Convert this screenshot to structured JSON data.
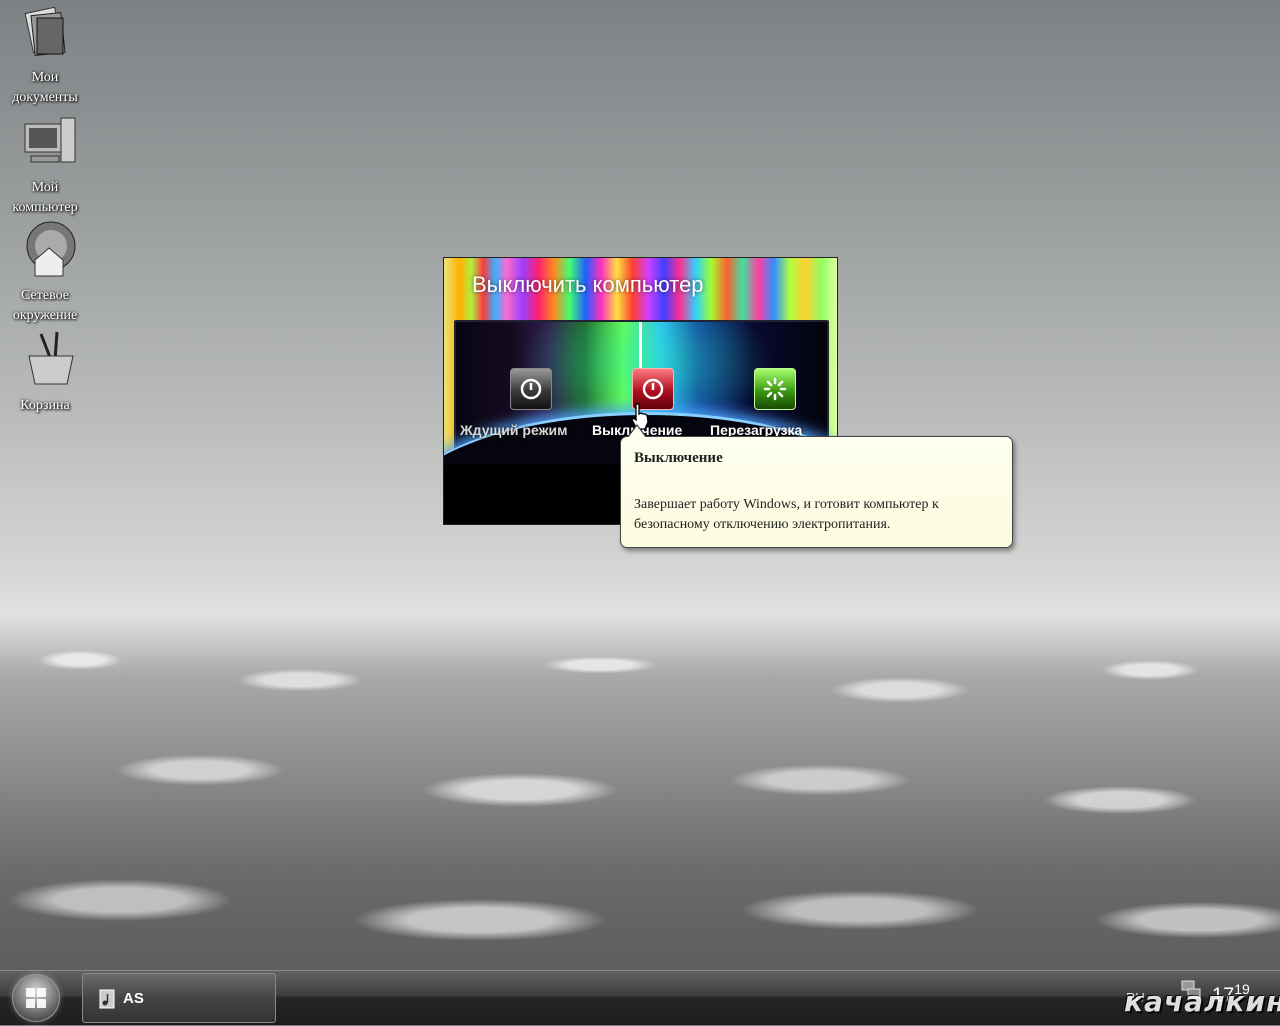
{
  "desktop": {
    "icons": [
      {
        "label": "Мои документы",
        "icon": "my-documents-icon"
      },
      {
        "label": "Мой компьютер",
        "icon": "my-computer-icon"
      },
      {
        "label": "Сетевое окружение",
        "icon": "network-icon"
      },
      {
        "label": "Корзина",
        "icon": "recycle-bin-icon"
      }
    ]
  },
  "dialog": {
    "title": "Выключить компьютер",
    "buttons": {
      "standby": "Ждущий режим",
      "shutdown": "Выключение",
      "restart": "Перезагрузка"
    }
  },
  "tooltip": {
    "title": "Выключение",
    "text": "Завершает работу Windows, и готовит компьютер к безопасному отключению электропитания."
  },
  "taskbar": {
    "task_label": "AS",
    "language": "RU",
    "clock_hour": "17",
    "clock_minute": "19",
    "watermark": "качалкин.ру"
  },
  "colors": {
    "tooltip_bg": "#fffff0",
    "shutdown_red": "#b01020",
    "restart_green": "#3c9a10",
    "taskbar": "#2a2a2a"
  }
}
